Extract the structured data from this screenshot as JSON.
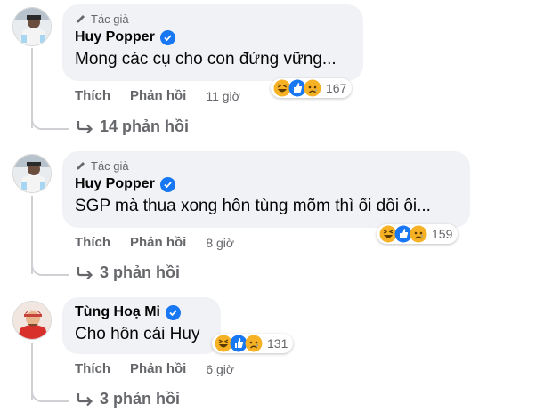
{
  "comments": [
    {
      "badge": "Tác giả",
      "author": "Huy Popper",
      "text": "Mong các cụ cho con đứng vững...",
      "like_label": "Thích",
      "reply_label": "Phản hồi",
      "time": "11 giờ",
      "reaction_count": "167",
      "reactions": [
        "haha-icon",
        "like-icon",
        "sad-icon"
      ],
      "replies_label": "14 phản hồi"
    },
    {
      "badge": "Tác giả",
      "author": "Huy Popper",
      "text": "SGP mà thua xong hôn tùng mõm thì ối dồi ôi...",
      "like_label": "Thích",
      "reply_label": "Phản hồi",
      "time": "8 giờ",
      "reaction_count": "159",
      "reactions": [
        "haha-icon",
        "like-icon",
        "sad-icon"
      ],
      "replies_label": "3 phản hồi"
    },
    {
      "author": "Tùng Hoạ Mi",
      "text": "Cho hôn cái Huy",
      "like_label": "Thích",
      "reply_label": "Phản hồi",
      "time": "6 giờ",
      "reaction_count": "131",
      "reactions": [
        "haha-icon",
        "like-icon",
        "sad-icon"
      ],
      "replies_label": "3 phản hồi"
    }
  ],
  "colors": {
    "bubble": "#f0f2f5",
    "secondary_text": "#65676b",
    "verified": "#1877f2",
    "haha": "#f7b125",
    "like": "#1877f2"
  }
}
